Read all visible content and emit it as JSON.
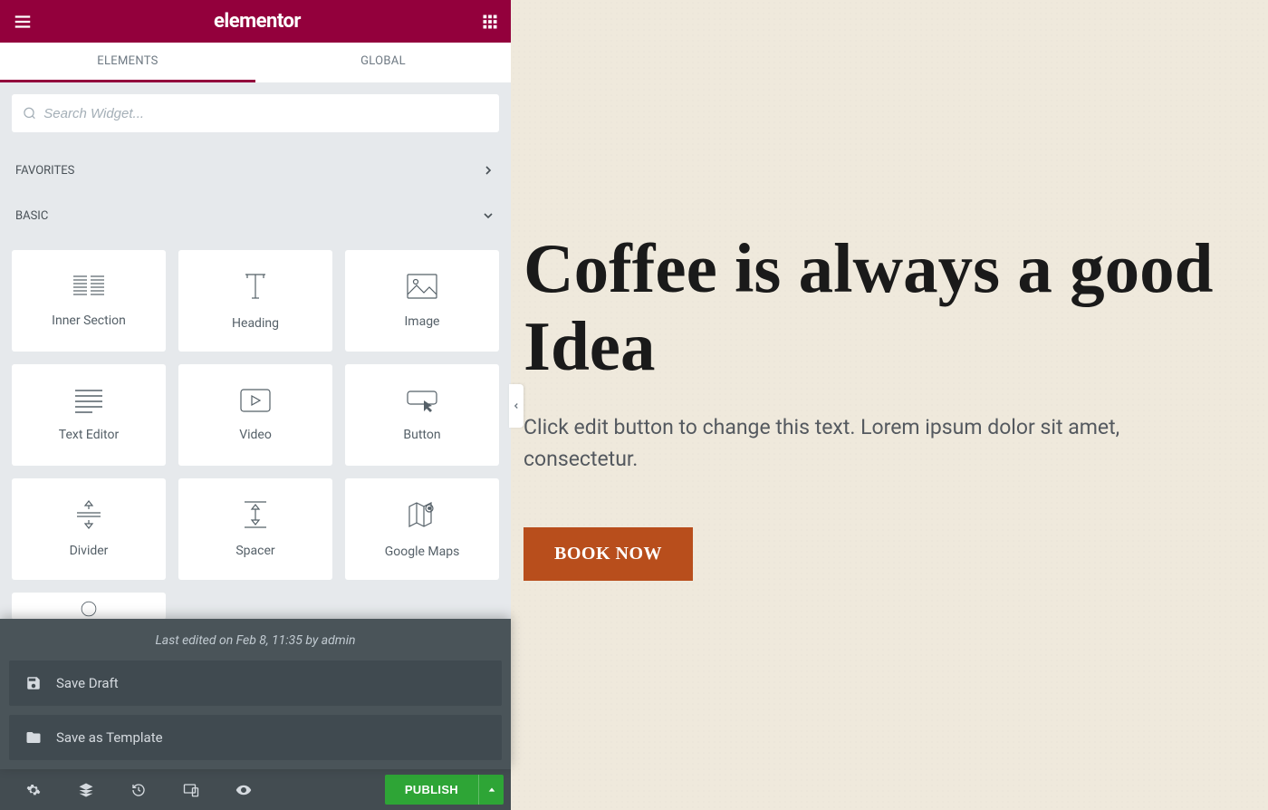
{
  "header": {
    "logo": "elementor"
  },
  "tabs": {
    "elements": "ELEMENTS",
    "global": "GLOBAL"
  },
  "search": {
    "placeholder": "Search Widget..."
  },
  "categories": {
    "favorites": "FAVORITES",
    "basic": "BASIC"
  },
  "widgets": [
    {
      "label": "Inner Section"
    },
    {
      "label": "Heading"
    },
    {
      "label": "Image"
    },
    {
      "label": "Text Editor"
    },
    {
      "label": "Video"
    },
    {
      "label": "Button"
    },
    {
      "label": "Divider"
    },
    {
      "label": "Spacer"
    },
    {
      "label": "Google Maps"
    }
  ],
  "popup": {
    "meta": "Last edited on Feb 8, 11:35 by admin",
    "save_draft": "Save Draft",
    "save_template": "Save as Template"
  },
  "bottom": {
    "publish": "PUBLISH"
  },
  "canvas": {
    "title": "Coffee is always a good Idea",
    "subtitle": "Click edit button to change this text. Lorem ipsum dolor sit amet, consectetur.",
    "cta": "BOOK NOW"
  },
  "colors": {
    "brand": "#93003c",
    "publish": "#2ea536",
    "cta": "#b84e1c"
  }
}
